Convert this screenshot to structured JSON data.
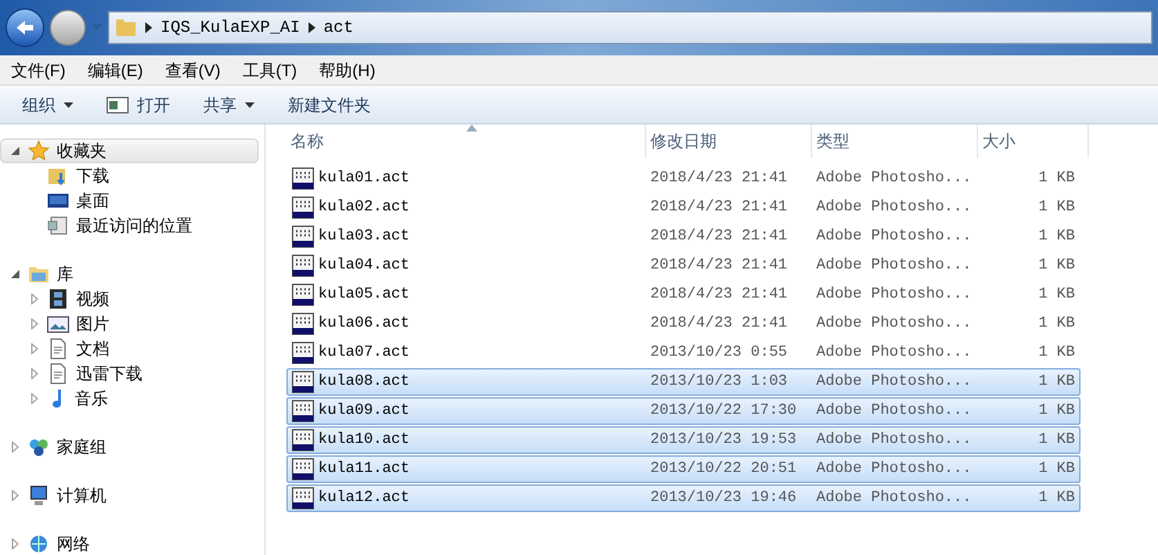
{
  "address": {
    "path": [
      "IQS_KulaEXP_AI",
      "act"
    ]
  },
  "menu": [
    "文件(F)",
    "编辑(E)",
    "查看(V)",
    "工具(T)",
    "帮助(H)"
  ],
  "toolbar": [
    {
      "label": "组织",
      "kind": "dropdown"
    },
    {
      "label": "打开",
      "kind": "open"
    },
    {
      "label": "共享",
      "kind": "dropdown"
    },
    {
      "label": "新建文件夹",
      "kind": "plain"
    }
  ],
  "sidebar": [
    {
      "label": "收藏夹",
      "kind": "star",
      "expanded": true,
      "selected": true,
      "children": [
        {
          "label": "下载",
          "kind": "download"
        },
        {
          "label": "桌面",
          "kind": "desktop"
        },
        {
          "label": "最近访问的位置",
          "kind": "recent"
        }
      ]
    },
    {
      "label": "库",
      "kind": "library",
      "expanded": true,
      "selected": false,
      "children": [
        {
          "label": "视频",
          "kind": "video",
          "expanded": false
        },
        {
          "label": "图片",
          "kind": "picture",
          "expanded": false
        },
        {
          "label": "文档",
          "kind": "document",
          "expanded": false
        },
        {
          "label": "迅雷下载",
          "kind": "document",
          "expanded": false
        },
        {
          "label": "音乐",
          "kind": "music",
          "expanded": false
        }
      ]
    },
    {
      "label": "家庭组",
      "kind": "homegroup",
      "expanded": false,
      "selected": false
    },
    {
      "label": "计算机",
      "kind": "computer",
      "expanded": false,
      "selected": false
    },
    {
      "label": "网络",
      "kind": "network",
      "expanded": false,
      "selected": false
    }
  ],
  "table": {
    "columns": [
      {
        "label": "名称",
        "sorted": true
      },
      {
        "label": "修改日期",
        "sorted": false
      },
      {
        "label": "类型",
        "sorted": false
      },
      {
        "label": "大小",
        "sorted": false
      }
    ],
    "rows": [
      {
        "name": "kula01.act",
        "date": "2018/4/23 21:41",
        "type": "Adobe Photosho...",
        "size": "1 KB",
        "selected": false
      },
      {
        "name": "kula02.act",
        "date": "2018/4/23 21:41",
        "type": "Adobe Photosho...",
        "size": "1 KB",
        "selected": false
      },
      {
        "name": "kula03.act",
        "date": "2018/4/23 21:41",
        "type": "Adobe Photosho...",
        "size": "1 KB",
        "selected": false
      },
      {
        "name": "kula04.act",
        "date": "2018/4/23 21:41",
        "type": "Adobe Photosho...",
        "size": "1 KB",
        "selected": false
      },
      {
        "name": "kula05.act",
        "date": "2018/4/23 21:41",
        "type": "Adobe Photosho...",
        "size": "1 KB",
        "selected": false
      },
      {
        "name": "kula06.act",
        "date": "2018/4/23 21:41",
        "type": "Adobe Photosho...",
        "size": "1 KB",
        "selected": false
      },
      {
        "name": "kula07.act",
        "date": "2013/10/23 0:55",
        "type": "Adobe Photosho...",
        "size": "1 KB",
        "selected": false
      },
      {
        "name": "kula08.act",
        "date": "2013/10/23 1:03",
        "type": "Adobe Photosho...",
        "size": "1 KB",
        "selected": true
      },
      {
        "name": "kula09.act",
        "date": "2013/10/22 17:30",
        "type": "Adobe Photosho...",
        "size": "1 KB",
        "selected": true
      },
      {
        "name": "kula10.act",
        "date": "2013/10/23 19:53",
        "type": "Adobe Photosho...",
        "size": "1 KB",
        "selected": true
      },
      {
        "name": "kula11.act",
        "date": "2013/10/22 20:51",
        "type": "Adobe Photosho...",
        "size": "1 KB",
        "selected": true
      },
      {
        "name": "kula12.act",
        "date": "2013/10/23 19:46",
        "type": "Adobe Photosho...",
        "size": "1 KB",
        "selected": true
      }
    ]
  }
}
